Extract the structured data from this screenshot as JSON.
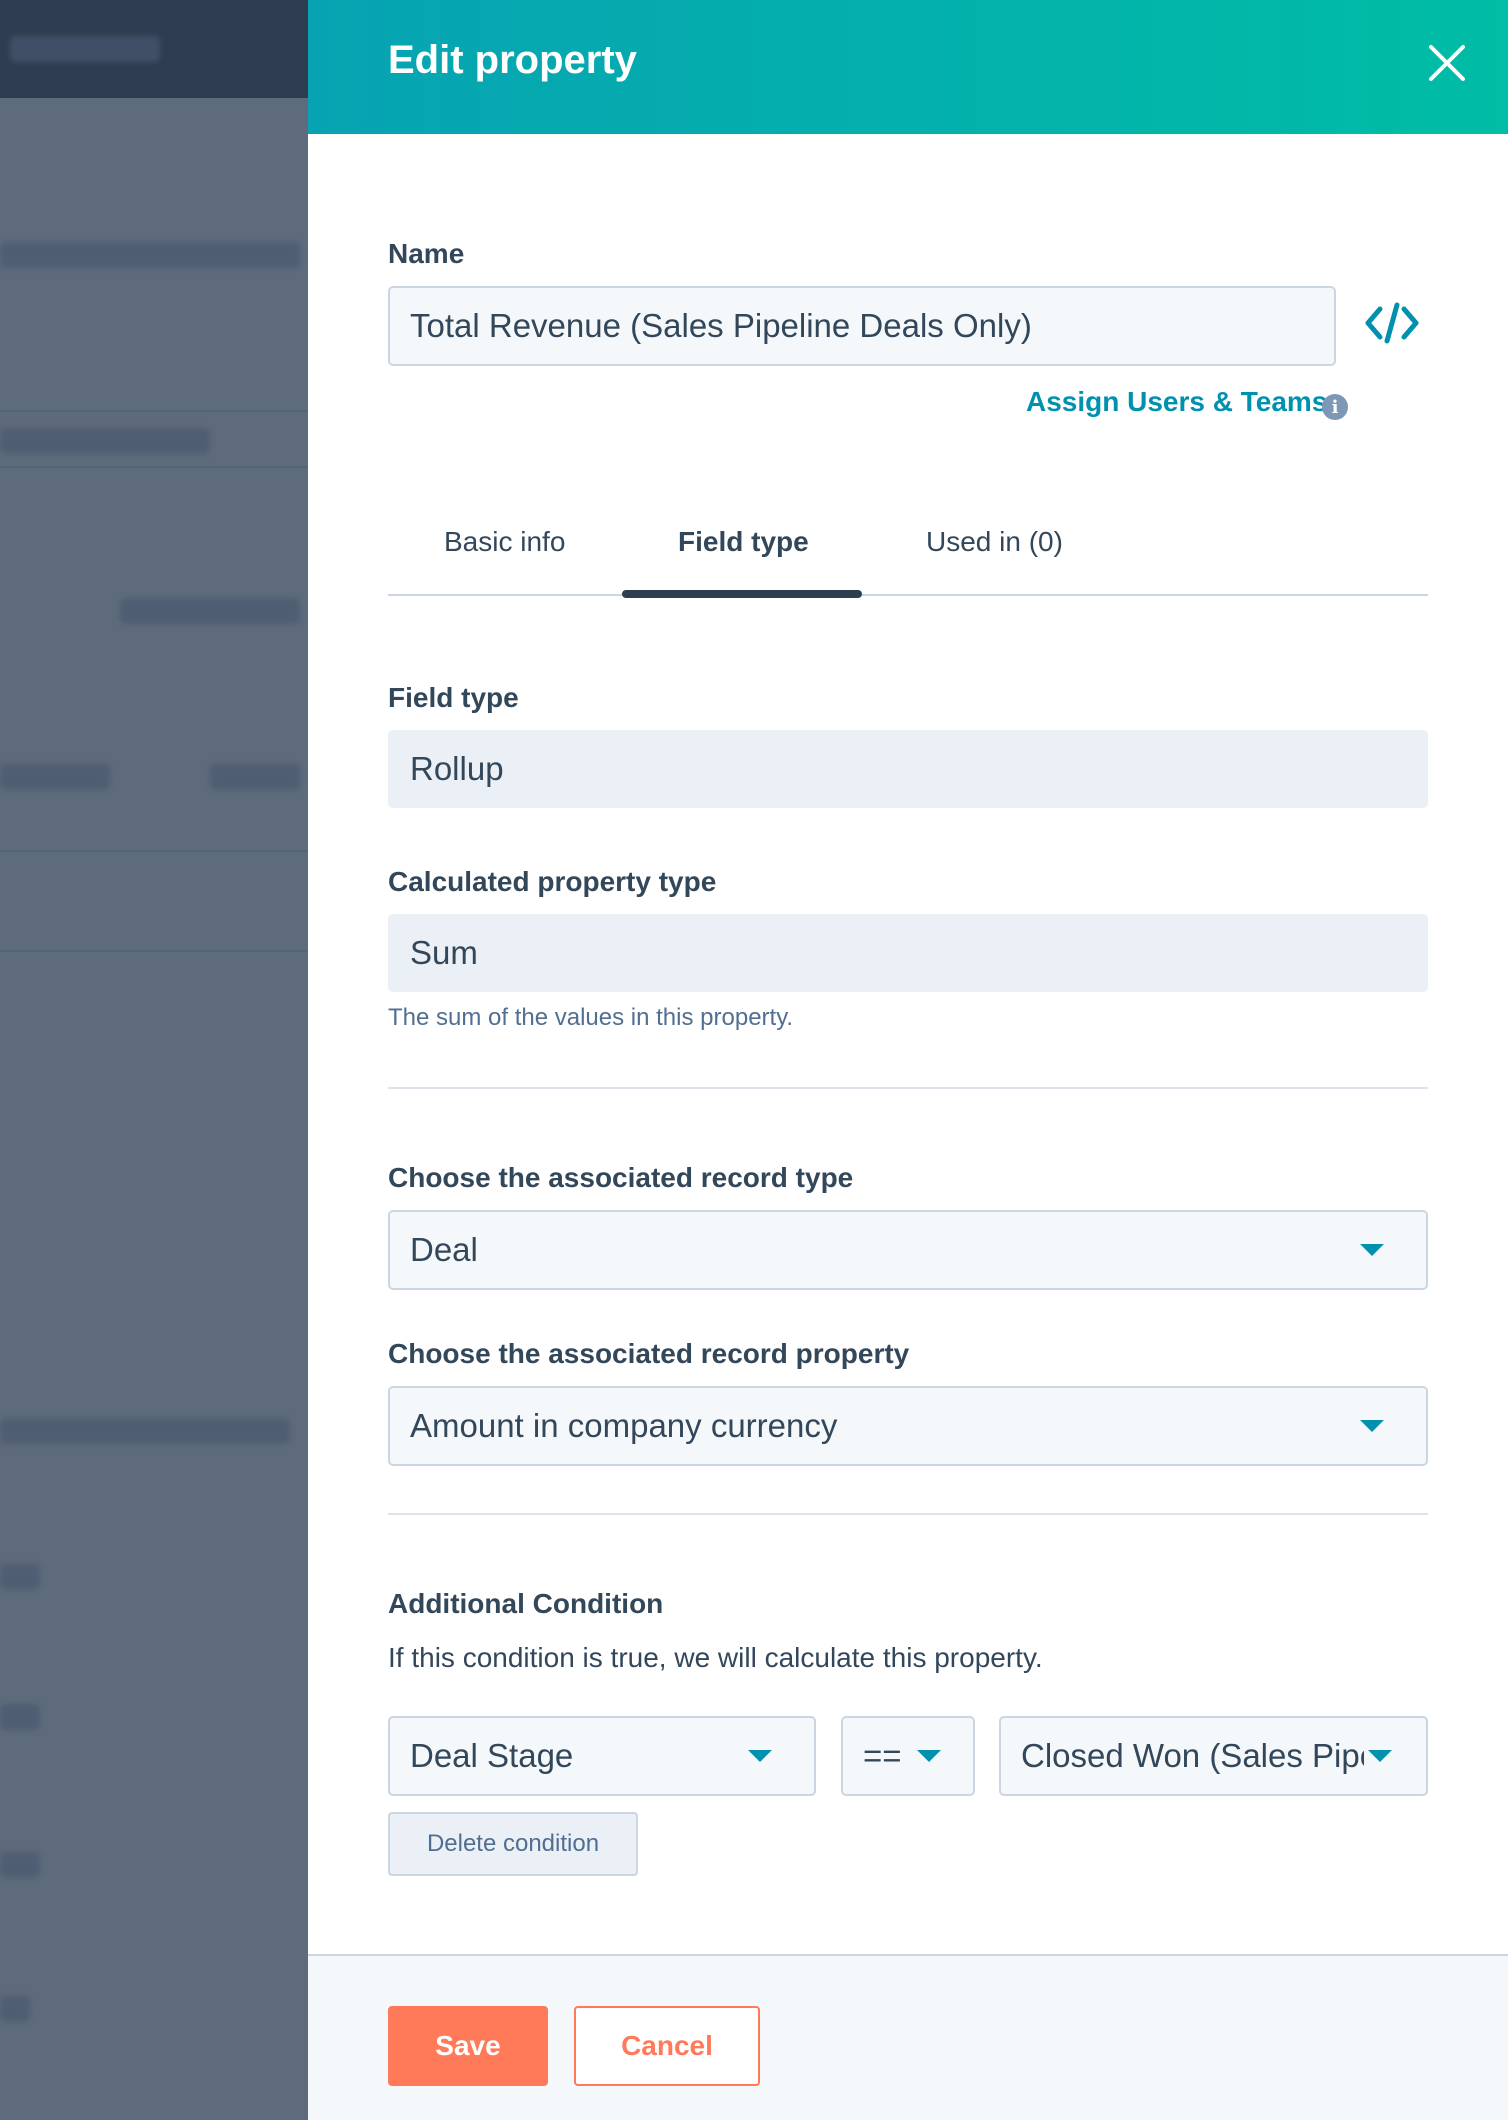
{
  "panel": {
    "title": "Edit property",
    "close_label": "close"
  },
  "name_field": {
    "label": "Name",
    "value": "Total Revenue (Sales Pipeline Deals Only)"
  },
  "assign_link": "Assign Users & Teams",
  "tabs": [
    {
      "label": "Basic info",
      "active": false
    },
    {
      "label": "Field type",
      "active": true
    },
    {
      "label": "Used in (0)",
      "active": false
    }
  ],
  "field_type": {
    "label": "Field type",
    "value": "Rollup"
  },
  "calculated_type": {
    "label": "Calculated property type",
    "value": "Sum",
    "help": "The sum of the values in this property."
  },
  "record_type": {
    "label": "Choose the associated record type",
    "value": "Deal"
  },
  "record_property": {
    "label": "Choose the associated record property",
    "value": "Amount in company currency"
  },
  "condition": {
    "label": "Additional Condition",
    "description": "If this condition is true, we will calculate this property.",
    "property": "Deal Stage",
    "operator": "==",
    "value": "Closed Won (Sales Pipeline)",
    "delete_label": "Delete condition"
  },
  "footer": {
    "save_label": "Save",
    "cancel_label": "Cancel"
  },
  "colors": {
    "header_gradient_start": "#07a3b3",
    "header_gradient_end": "#00bda5",
    "accent": "#0091ae",
    "primary_button": "#ff7a59"
  }
}
